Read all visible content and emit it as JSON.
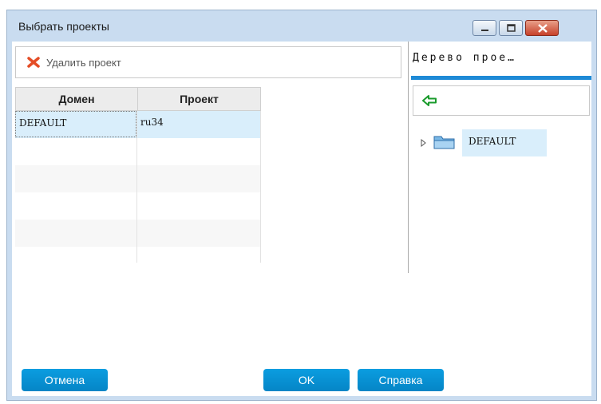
{
  "window": {
    "title": "Выбрать проекты"
  },
  "toolbar": {
    "delete_label": "Удалить проект"
  },
  "grid": {
    "columns": [
      "Домен",
      "Проект"
    ],
    "rows": [
      {
        "domain": "DEFAULT",
        "project": "ru34"
      }
    ]
  },
  "tree": {
    "title": "Дерево прое…",
    "nodes": [
      {
        "label": "DEFAULT"
      }
    ]
  },
  "buttons": {
    "cancel": "Отмена",
    "ok": "OK",
    "help": "Справка"
  },
  "icons": {
    "delete": "red-x-icon",
    "back": "green-back-arrow-icon",
    "expand": "triangle-right-icon",
    "folder": "folder-icon"
  },
  "colors": {
    "accent": "#1e8ad6",
    "button": "#0b9de0",
    "selection": "#d9eefb",
    "delete_icon": "#e44d26",
    "back_arrow": "#1a9b2c"
  }
}
